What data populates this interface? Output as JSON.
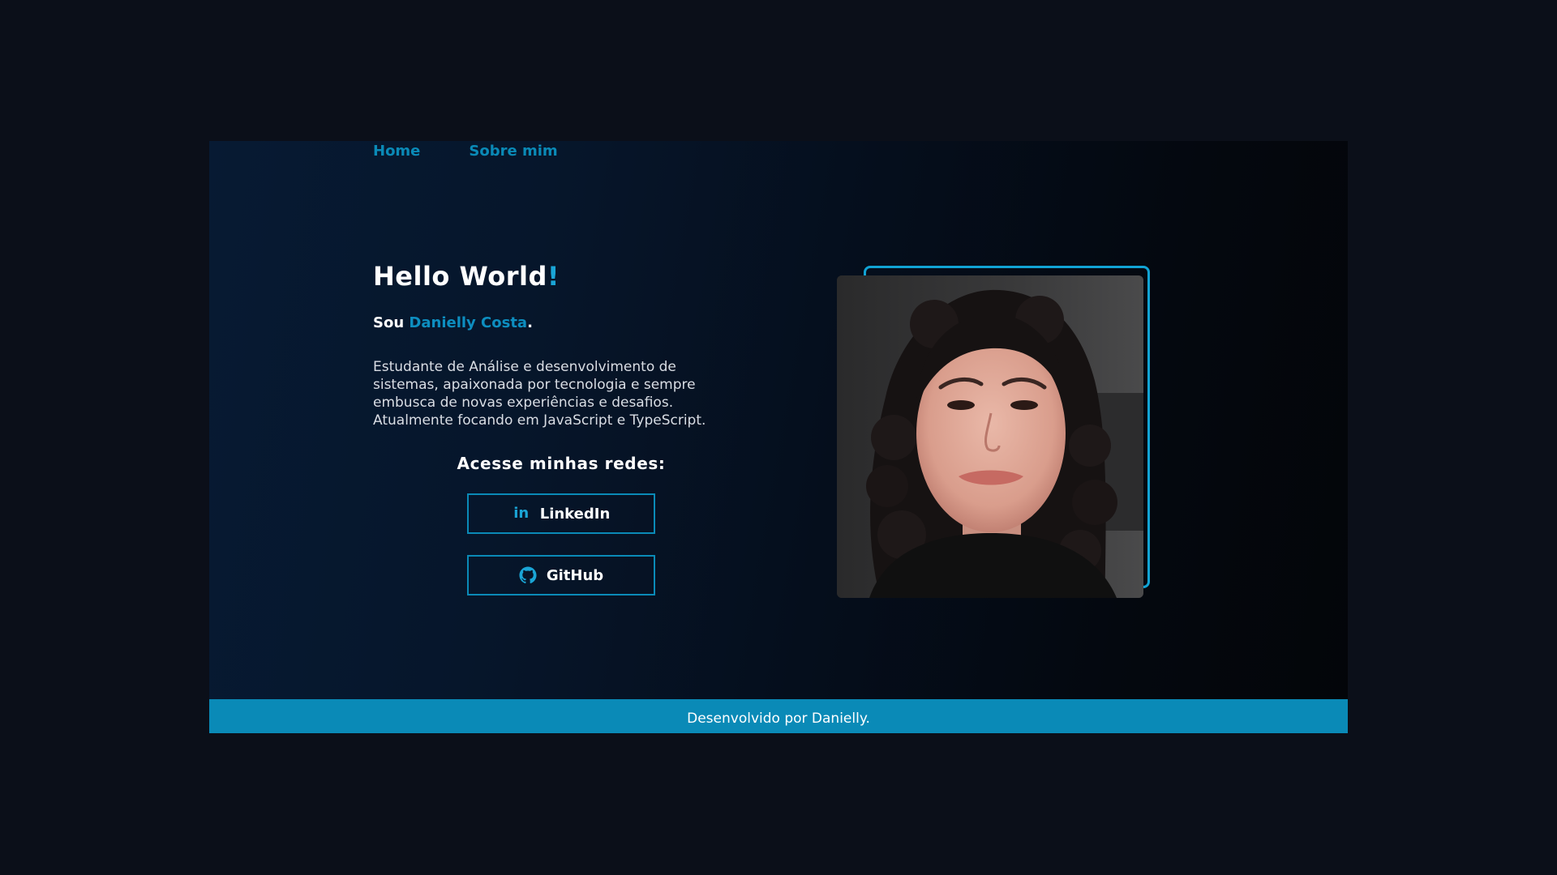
{
  "nav": {
    "home_label": "Home",
    "about_label": "Sobre mim"
  },
  "hero": {
    "title": "Hello World",
    "title_accent": "!",
    "intro_prefix": "Sou ",
    "name": "Danielly Costa",
    "intro_suffix": ".",
    "description": "Estudante de Análise e desenvolvimento de sistemas, apaixonada por tecnologia e sempre embusca de novas experiências e desafios. Atualmente focando em JavaScript e TypeScript."
  },
  "social": {
    "title": "Acesse minhas redes:",
    "linkedin": {
      "label": "LinkedIn",
      "icon": "linkedin-icon"
    },
    "github": {
      "label": "GitHub",
      "icon": "github-icon"
    }
  },
  "profile": {
    "photo": "profile-photo"
  },
  "footer": {
    "text": "Desenvolvido por Danielly."
  },
  "colors": {
    "accent": "#0a8ab7",
    "accent_light": "#1aa5d6",
    "page_background": "#0b0f19",
    "footer_background": "#0a8ab7",
    "text": "#ffffff"
  }
}
